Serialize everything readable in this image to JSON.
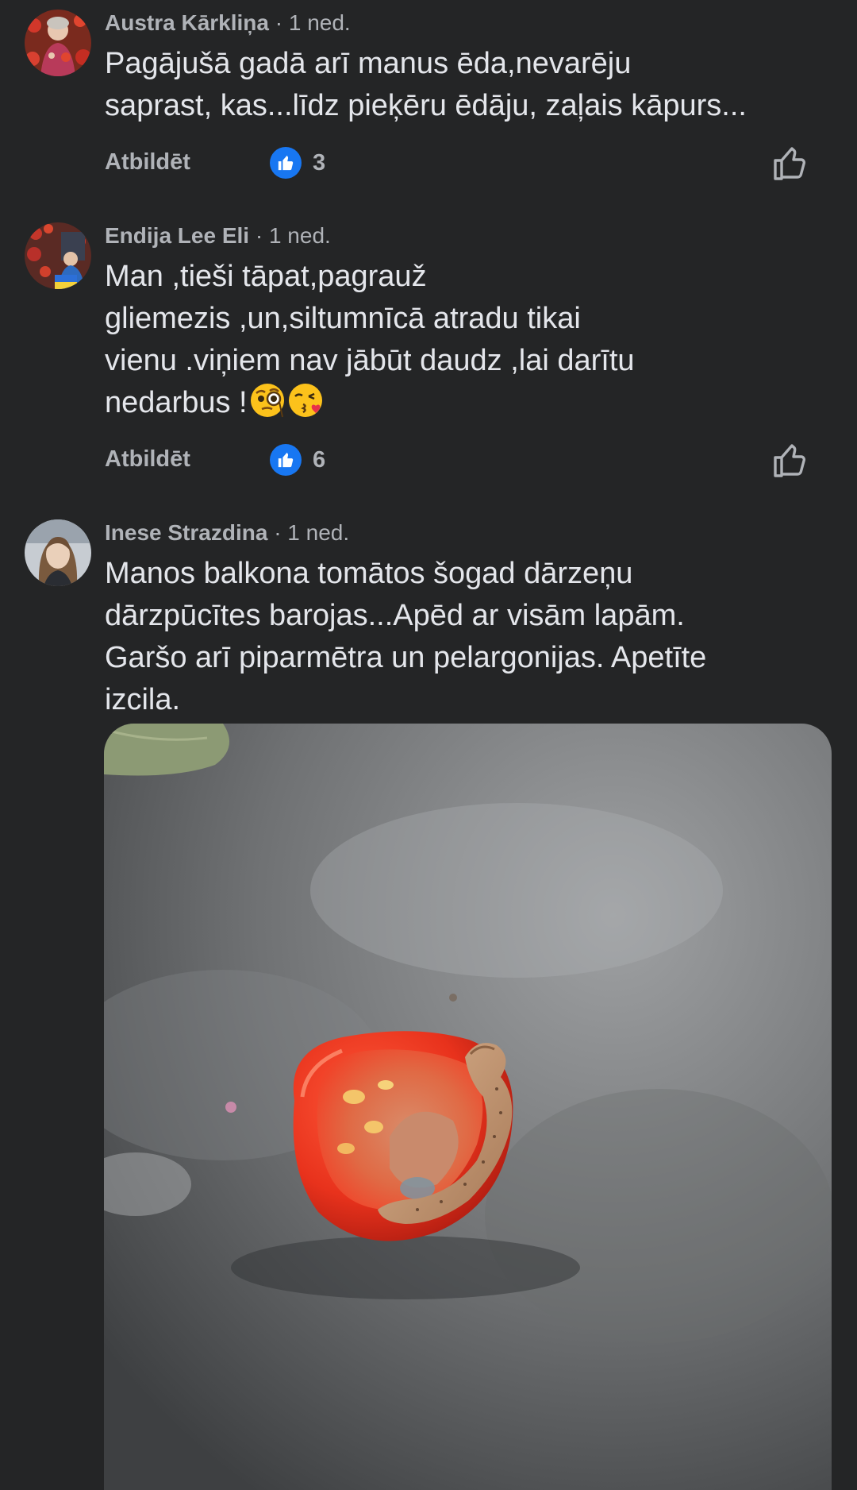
{
  "comments": [
    {
      "author": "Austra Kārkliņa",
      "separator": "·",
      "time": "1 ned.",
      "text_lines": [
        "Pagājušā  gadā arī  manus ēda,nevarēju",
        "saprast, kas...līdz pieķēru ēdāju, zaļais kāpurs..."
      ],
      "reply_label": "Atbildēt",
      "like_count": "3"
    },
    {
      "author": "Endija Lee Eli",
      "separator": "·",
      "time": "1 ned.",
      "text_lines": [
        "Man ,tieši tāpat,pagrauž",
        "gliemezis ,un,siltumnīcā atradu tikai",
        "vienu .viņiem nav jābūt daudz ,lai darītu",
        "nedarbus !"
      ],
      "emojis": [
        "face-with-monocle",
        "face-blowing-kiss"
      ],
      "reply_label": "Atbildēt",
      "like_count": "6"
    },
    {
      "author": "Inese Strazdina",
      "separator": "·",
      "time": "1 ned.",
      "text_lines": [
        "Manos balkona tomātos šogad dārzeņu",
        "dārzpūcītes barojas...Apēd ar visām lapām.",
        "Garšo arī piparmētra un pelargonijas. Apetīte",
        "izcila."
      ],
      "photo": "tomato-with-caterpillar"
    }
  ],
  "colors": {
    "background": "#242526",
    "primary_text": "#e4e6eb",
    "secondary_text": "#b0b3b8",
    "like_blue": "#1877f2"
  }
}
